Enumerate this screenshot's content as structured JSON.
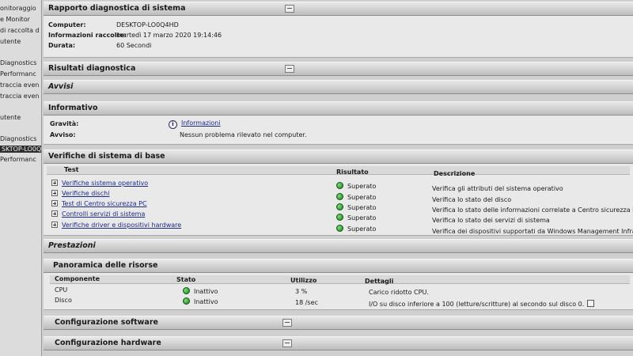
{
  "tree": {
    "items": [
      {
        "label": "onitoraggio",
        "selected": false
      },
      {
        "label": "e Monitor",
        "selected": false
      },
      {
        "label": "di raccolta d",
        "selected": false
      },
      {
        "label": "utente",
        "selected": false
      },
      {
        "label": "Diagnostics",
        "selected": false
      },
      {
        "label": "Performanc",
        "selected": false
      },
      {
        "label": "traccia even",
        "selected": false
      },
      {
        "label": "traccia even",
        "selected": false
      },
      {
        "label": "utente",
        "selected": false
      },
      {
        "label": "Diagnostics",
        "selected": false
      },
      {
        "label": "SKTOP-LO0Q",
        "selected": true
      },
      {
        "label": "Performanc",
        "selected": false
      }
    ]
  },
  "report": {
    "title": "Rapporto diagnostica di sistema",
    "computer_label": "Computer:",
    "computer_value": "DESKTOP-LO0Q4HD",
    "collected_label": "Informazioni raccolte:",
    "collected_value": "martedì 17 marzo 2020 19:14:46",
    "duration_label": "Durata:",
    "duration_value": "60 Secondi"
  },
  "sections": {
    "results": "Risultati diagnostica",
    "warnings": "Avvisi",
    "informative": "Informativo",
    "basic_checks": "Verifiche di sistema di base",
    "performance": "Prestazioni",
    "resources": "Panoramica delle risorse",
    "software": "Configurazione software",
    "hardware": "Configurazione hardware"
  },
  "informative": {
    "severity_label": "Gravità:",
    "severity_value": "Informazioni",
    "warning_label": "Avviso:",
    "warning_value": "Nessun problema rilevato nel computer."
  },
  "basic_checks": {
    "headers": {
      "test": "Test",
      "result": "Risultato",
      "description": "Descrizione"
    },
    "rows": [
      {
        "test": "Verifiche sistema operativo",
        "result": "Superato",
        "description": "Verifica gli attributi del sistema operativo"
      },
      {
        "test": "Verifiche dischi",
        "result": "Superato",
        "description": "Verifica lo stato del disco"
      },
      {
        "test": "Test di Centro sicurezza PC",
        "result": "Superato",
        "description": "Verifica lo stato delle informazioni correlate a Centro sicurezza PC."
      },
      {
        "test": "Controlli servizi di sistema",
        "result": "Superato",
        "description": "Verifica lo stato dei servizi di sistema"
      },
      {
        "test": "Verifiche driver e dispositivi hardware",
        "result": "Superato",
        "description": "Verifica dei dispositivi supportati da Windows Management Infrastru"
      }
    ]
  },
  "resources": {
    "headers": {
      "component": "Componente",
      "status": "Stato",
      "usage": "Utilizzo",
      "details": "Dettagli"
    },
    "rows": [
      {
        "component": "CPU",
        "status": "Inattivo",
        "usage": "3 %",
        "details": "Carico ridotto CPU."
      },
      {
        "component": "Disco",
        "status": "Inattivo",
        "usage": "18 /sec",
        "details": "I/O su disco inferiore a 100 (letture/scritture) al secondo sul disco 0."
      }
    ]
  }
}
